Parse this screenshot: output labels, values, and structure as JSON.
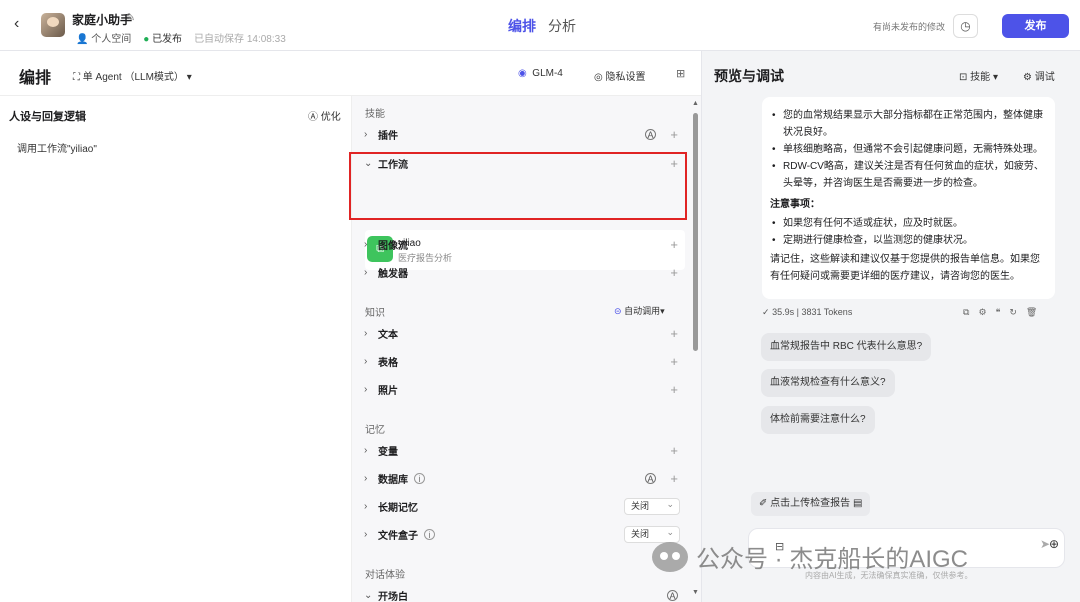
{
  "header": {
    "bot_name": "家庭小助手",
    "space": "个人空间",
    "status": "已发布",
    "autosave": "已自动保存 14:08:33",
    "tabs": [
      "编排",
      "分析"
    ],
    "unpublished": "有尚未发布的修改",
    "publish": "发布"
  },
  "arrange": {
    "title": "编排",
    "agent_mode": "单 Agent （LLM模式）",
    "model": "GLM-4",
    "privacy": "隐私设置"
  },
  "persona": {
    "title": "人设与回复逻辑",
    "optimize": "优化",
    "text": "调用工作流\"yiliao\""
  },
  "skills_panel": {
    "skills_label": "技能",
    "plugin": "插件",
    "workflow": "工作流",
    "workflow_item": {
      "name": "yiliao",
      "desc": "医疗报告分析"
    },
    "imageflow": "图像流",
    "trigger": "触发器",
    "knowledge_label": "知识",
    "auto_call": "自动调用",
    "text": "文本",
    "table": "表格",
    "photo": "照片",
    "memory_label": "记忆",
    "variable": "变量",
    "database": "数据库",
    "long_memory": "长期记忆",
    "long_memory_value": "关闭",
    "filebox": "文件盒子",
    "filebox_value": "关闭",
    "dialog_label": "对话体验",
    "opening": "开场白"
  },
  "preview": {
    "title": "预览与调试",
    "skills": "技能",
    "debug": "调试",
    "bullets1": [
      "您的血常规结果显示大部分指标都在正常范围内，整体健康状况良好。",
      "单核细胞略高，但通常不会引起健康问题，无需特殊处理。",
      "RDW-CV略高，建议关注是否有任何贫血的症状，如疲劳、头晕等，并咨询医生是否需要进一步的检查。"
    ],
    "notes_title": "注意事项：",
    "bullets2": [
      "如果您有任何不适或症状，应及时就医。",
      "定期进行健康检查，以监测您的健康状况。"
    ],
    "closing": "请记住，这些解读和建议仅基于您提供的报告单信息。如果您有任何疑问或需要更详细的医疗建议，请咨询您的医生。",
    "time": "35.9s",
    "tokens": "3831 Tokens",
    "suggestions": [
      "血常规报告中 RBC 代表什么意思?",
      "血液常规检查有什么意义?",
      "体检前需要注意什么?"
    ],
    "upload": "点击上传检查报告",
    "disclaimer": "内容由AI生成，无法确保真实准确，仅供参考。"
  },
  "watermark": "公众号 · 杰克船长的AIGC"
}
